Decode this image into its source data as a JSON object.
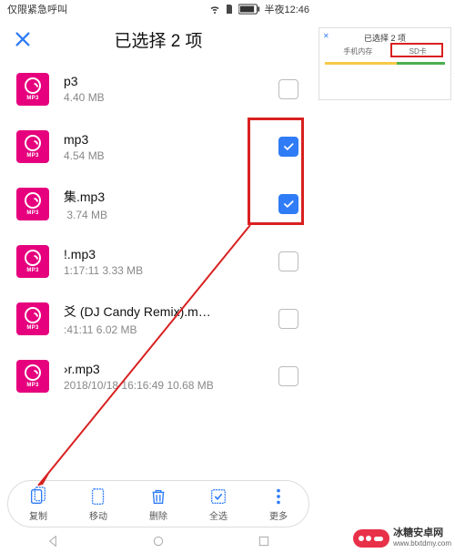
{
  "status": {
    "left": "仅限紧急呼叫",
    "right_time": "半夜12:46"
  },
  "header": {
    "title": "已选择 2 项"
  },
  "toolbar": {
    "copy": "复制",
    "move": "移动",
    "delete": "删除",
    "selectall": "全选",
    "more": "更多"
  },
  "mp3_label": "MP3",
  "files": [
    {
      "name": "p3",
      "meta": "4.40 MB",
      "checked": false
    },
    {
      "name": "mp3",
      "meta": "4.54 MB",
      "checked": true
    },
    {
      "name": "集.mp3",
      "meta": "‎    3.74 MB",
      "checked": true
    },
    {
      "name": "!.mp3",
      "meta": "1:17:11 3.33 MB",
      "checked": false
    },
    {
      "name": "爻 (DJ Candy Remix).m…",
      "meta": ":41:11 6.02 MB",
      "checked": false
    },
    {
      "name": "›r.mp3",
      "meta": "2018/10/18 16:16:49 10.68 MB",
      "checked": false
    }
  ],
  "thumb": {
    "title": "已选择 2 项",
    "col1": "手机内存",
    "col2": "SD卡"
  },
  "watermark": {
    "cn": "冰糖安卓网",
    "url": "www.btxtdmy.com"
  },
  "annotations": {
    "highlight_box": "red rectangle around checkboxes of rows 2–3",
    "arrow": "red arrow from highlight box to copy tool in bottom pill",
    "thumb_box": "red rectangle around SD卡 column in floating thumbnail"
  },
  "colors": {
    "accent": "#2f7cf6",
    "brand": "#e6007e",
    "danger": "#d92020"
  }
}
